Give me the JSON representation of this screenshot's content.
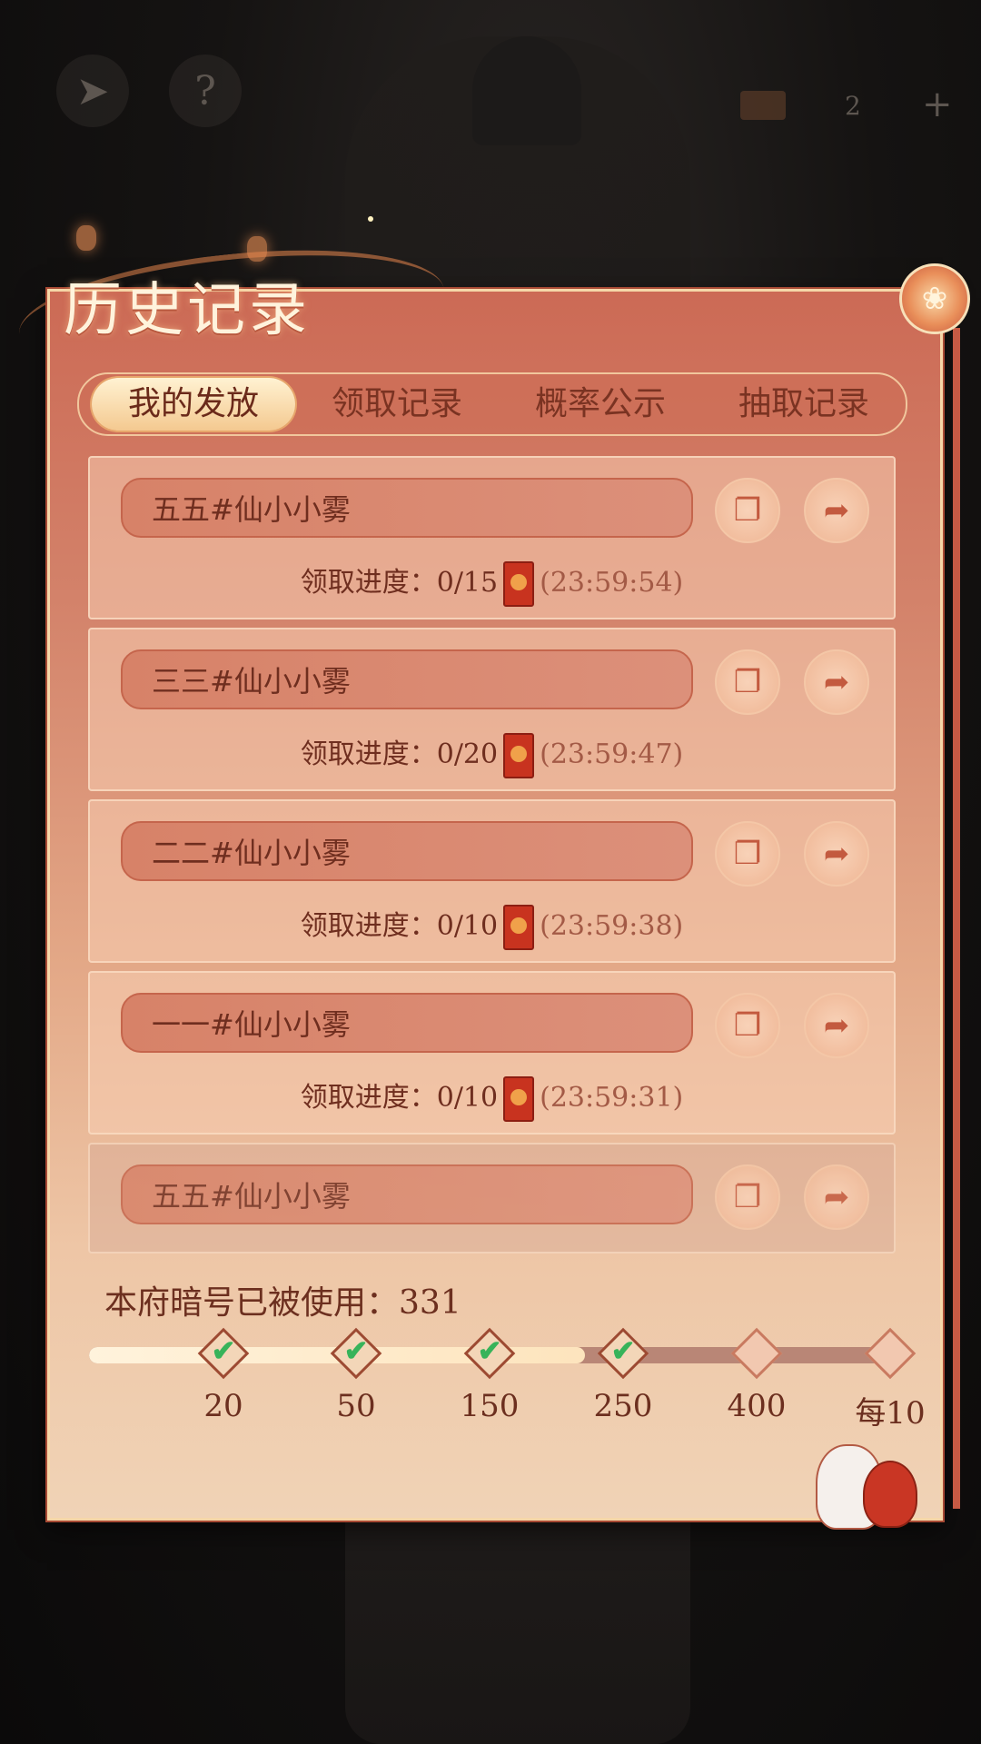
{
  "topbar": {
    "back_icon": "back-arrow-icon",
    "help_icon": "question-icon",
    "ticket_count": "2",
    "plus_label": "+"
  },
  "panel": {
    "title": "历史记录",
    "tabs": [
      {
        "label": "我的发放",
        "active": true
      },
      {
        "label": "领取记录",
        "active": false
      },
      {
        "label": "概率公示",
        "active": false
      },
      {
        "label": "抽取记录",
        "active": false
      }
    ]
  },
  "records": [
    {
      "name": "五五#仙小小雾",
      "progress_label": "领取进度：",
      "progress": "0/15",
      "time": "(23:59:54)"
    },
    {
      "name": "三三#仙小小雾",
      "progress_label": "领取进度：",
      "progress": "0/20",
      "time": "(23:59:47)"
    },
    {
      "name": "二二#仙小小雾",
      "progress_label": "领取进度：",
      "progress": "0/10",
      "time": "(23:59:38)"
    },
    {
      "name": "一一#仙小小雾",
      "progress_label": "领取进度：",
      "progress": "0/10",
      "time": "(23:59:31)"
    },
    {
      "name": "五五#仙小小雾"
    }
  ],
  "usage": {
    "label": "本府暗号已被使用：",
    "count": "331",
    "fill_fraction": 0.62,
    "milestones": [
      {
        "label": "20",
        "reached": true
      },
      {
        "label": "50",
        "reached": true
      },
      {
        "label": "150",
        "reached": true
      },
      {
        "label": "250",
        "reached": true
      },
      {
        "label": "400",
        "reached": false
      },
      {
        "label": "每10",
        "reached": false
      }
    ]
  },
  "colors": {
    "accent": "#c8331f",
    "check": "#37b35a",
    "text_dark": "#6c2f1f"
  }
}
